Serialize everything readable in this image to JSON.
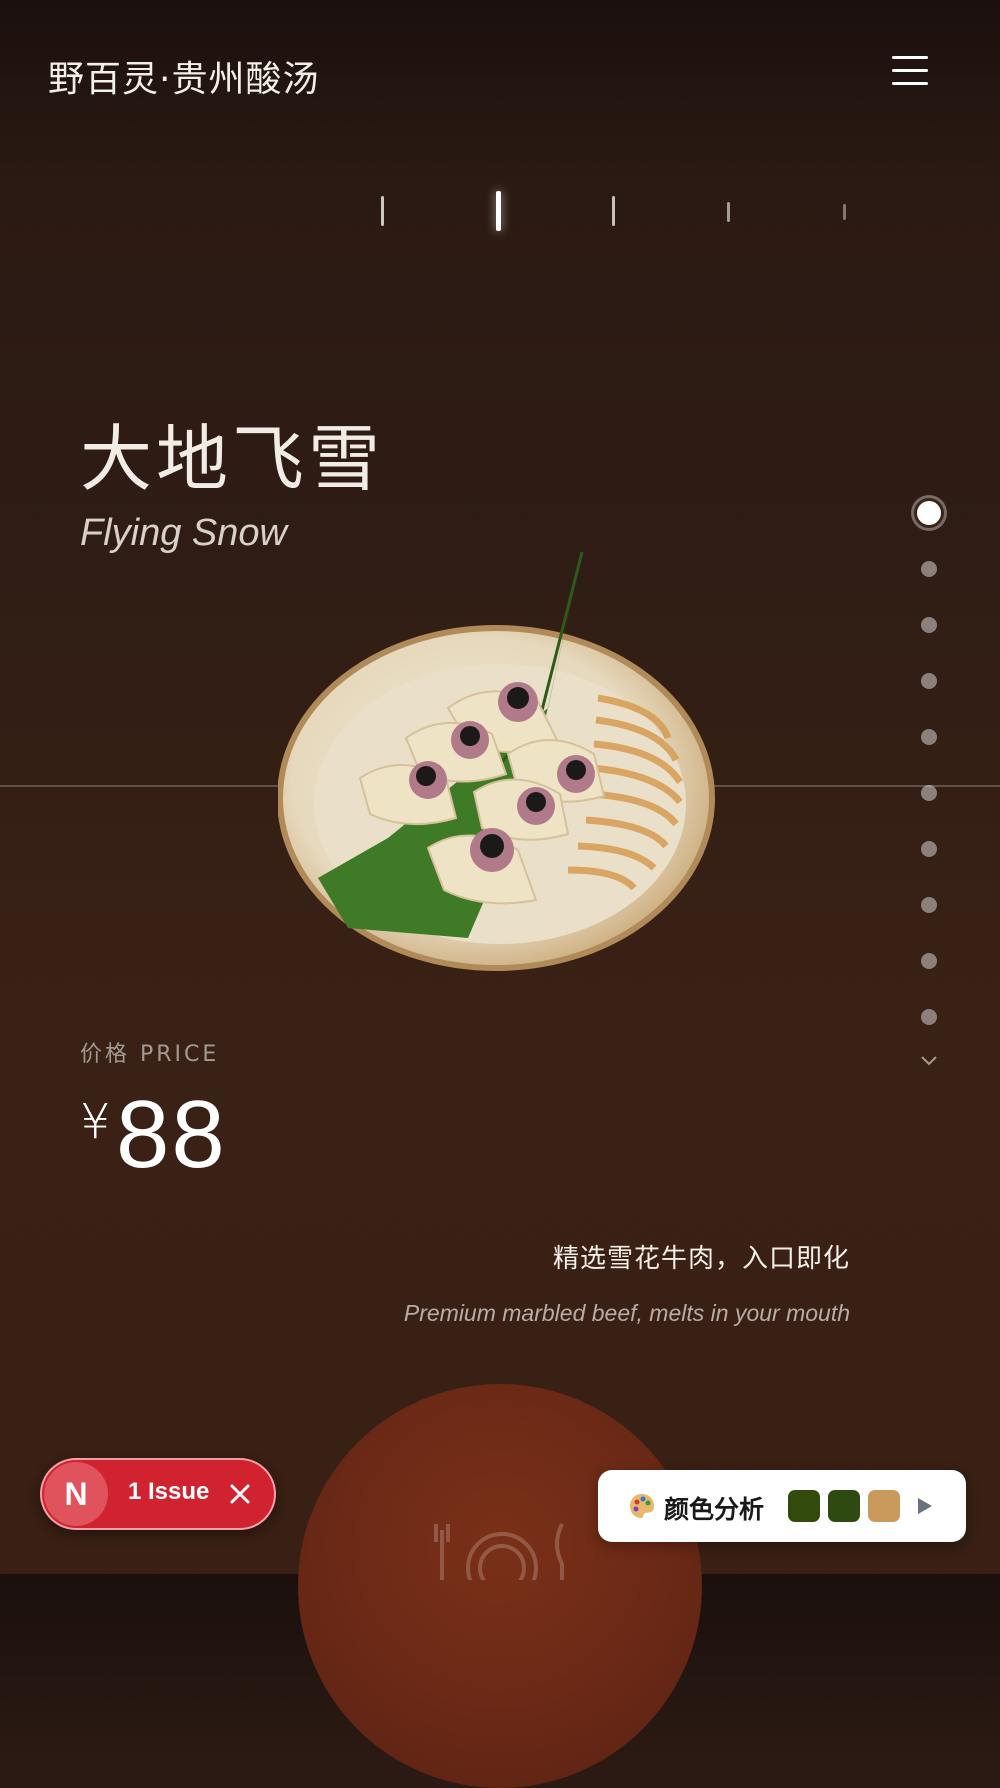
{
  "header": {
    "brand": "野百灵·贵州酸汤",
    "menu_icon": "hamburger-menu-icon"
  },
  "dish": {
    "title_cn": "大地飞雪",
    "title_en": "Flying Snow",
    "image_icon": "dumpling-plate-image",
    "price_label": "价格 PRICE",
    "currency": "¥",
    "price": "88",
    "desc_cn": "精选雪花牛肉，入口即化",
    "desc_en": "Premium marbled beef, melts in your mouth"
  },
  "pagination": {
    "count": 10,
    "active_index": 0,
    "next_icon": "chevron-down-icon"
  },
  "issue_badge": {
    "badge_letter": "N",
    "label": "1 Issue",
    "close_icon": "close-icon"
  },
  "color_panel": {
    "icon": "palette-icon",
    "label": "颜色分析",
    "swatches": [
      "#334a0d",
      "#2e4a10",
      "#c99a5c"
    ],
    "play_icon": "play-icon"
  },
  "colors": {
    "accent_red": "#d0222f",
    "orb": "#6d2a16",
    "background": "#2f1d15"
  }
}
